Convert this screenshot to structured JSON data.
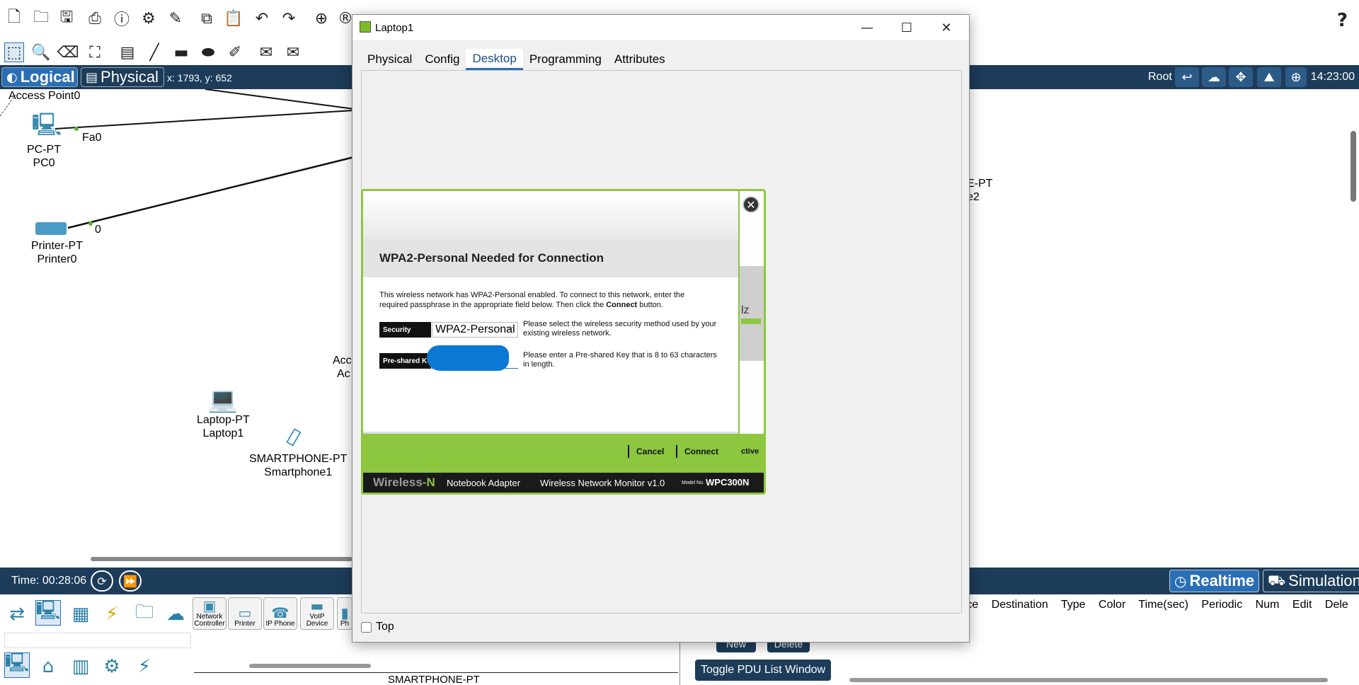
{
  "toolbar": {
    "icons": [
      "new-file-icon",
      "open-folder-icon",
      "save-icon",
      "print-icon",
      "info-icon",
      "network-wizard-icon",
      "activity-wizard-icon",
      "copy-icon",
      "paste-icon",
      "undo-icon",
      "redo-icon",
      "zoom-in-icon",
      "zoom-reset-icon"
    ],
    "help": "?"
  },
  "toolbar2": {
    "icons": [
      "select-icon",
      "inspect-icon",
      "delete-icon",
      "resize-icon",
      "note-icon",
      "draw-line-icon",
      "rectangle-icon",
      "ellipse-icon",
      "freeform-icon",
      "simple-pdu-icon",
      "complex-pdu-icon"
    ]
  },
  "nav": {
    "logical": "Logical",
    "physical": "Physical",
    "coords": "x: 1793, y: 652",
    "root": "Root",
    "clock": "14:23:00"
  },
  "workspace": {
    "devices": [
      {
        "type": "PC-PT",
        "name": "PC0"
      },
      {
        "type": "Printer-PT",
        "name": "Printer0"
      },
      {
        "type": "Laptop-PT",
        "name": "Laptop1"
      },
      {
        "type": "SMARTPHONE-PT",
        "name": "Smartphone1"
      }
    ],
    "partial_labels": {
      "access_point": "Access Point0",
      "port_fa0": "Fa0",
      "port_0": "0",
      "acc1": "Acc",
      "acc2": "Ac",
      "right1": "E-PT",
      "right2": "e2"
    }
  },
  "bottombar": {
    "time": "Time: 00:28:06",
    "realtime": "Realtime",
    "simulation": "Simulation"
  },
  "bottom_panel": {
    "device_tiles": [
      "Network Controller",
      "Printer",
      "IP Phone",
      "VoIP Device",
      "Ph"
    ],
    "pdu_headers": [
      "rce",
      "Destination",
      "Type",
      "Color",
      "Time(sec)",
      "Periodic",
      "Num",
      "Edit",
      "Dele"
    ],
    "new_label": "New",
    "delete_label": "Delete",
    "toggle_pdu": "Toggle PDU List Window",
    "device_caption": "SMARTPHONE-PT"
  },
  "window": {
    "title": "Laptop1",
    "tabs": [
      {
        "label": "Physical",
        "active": false
      },
      {
        "label": "Config",
        "active": false
      },
      {
        "label": "Desktop",
        "active": true
      },
      {
        "label": "Programming",
        "active": false
      },
      {
        "label": "Attributes",
        "active": false
      }
    ],
    "top_checkbox": {
      "label": "Top",
      "checked": false
    }
  },
  "wpc": {
    "title": "WPA2-Personal Needed for Connection",
    "desc_prefix": "This wireless network has WPA2-Personal enabled. To connect to this network, enter the required passphrase in the appropriate field below. Then click the ",
    "desc_bold": "Connect",
    "desc_suffix": " button.",
    "security_label": "Security",
    "security_value": "WPA2-Personal",
    "security_help": "Please select the wireless security method used by your existing wireless network.",
    "psk_label": "Pre-shared Key",
    "psk_help": "Please enter a Pre-shared Key that is 8 to 63 characters in length.",
    "cancel": "Cancel",
    "connect": "Connect",
    "right_partial": "lz",
    "right_active": "ctive",
    "footer": {
      "brand": "Wireless-",
      "brand_n": "N",
      "adapter": "Notebook Adapter",
      "monitor": "Wireless Network Monitor  v1.0",
      "model_label": "Model No.",
      "model": "WPC300N"
    },
    "colors": {
      "accent": "#8dc63f",
      "psk_redaction": "#0a78d4"
    }
  }
}
